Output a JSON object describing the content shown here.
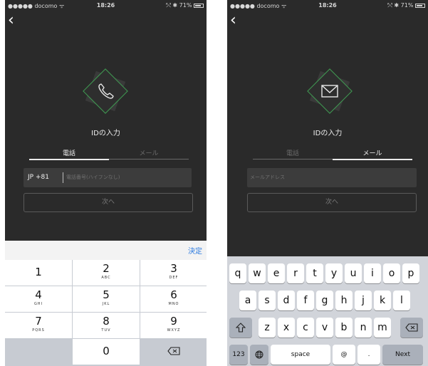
{
  "status": {
    "carrier": "●●●●● docomo ᯤ",
    "time": "18:26",
    "battery_left": "⤲ ✱ 71%",
    "battery_right": "⤲ ✱ 71%"
  },
  "screen": {
    "back": "‹",
    "title": "IDの入力",
    "tab_phone": "電話",
    "tab_mail": "メール",
    "country_code": "JP +81",
    "phone_placeholder": "電話番号(ハイフンなし)",
    "mail_placeholder": "メールアドレス",
    "next": "次へ"
  },
  "numpad": {
    "done": "決定",
    "keys": [
      {
        "digit": "1",
        "letters": ""
      },
      {
        "digit": "2",
        "letters": "ABC"
      },
      {
        "digit": "3",
        "letters": "DEF"
      },
      {
        "digit": "4",
        "letters": "GHI"
      },
      {
        "digit": "5",
        "letters": "JKL"
      },
      {
        "digit": "6",
        "letters": "MNO"
      },
      {
        "digit": "7",
        "letters": "PQRS"
      },
      {
        "digit": "8",
        "letters": "TUV"
      },
      {
        "digit": "9",
        "letters": "WXYZ"
      }
    ],
    "zero": "0"
  },
  "keyboard": {
    "row1": [
      "q",
      "w",
      "e",
      "r",
      "t",
      "y",
      "u",
      "i",
      "o",
      "p"
    ],
    "row2": [
      "a",
      "s",
      "d",
      "f",
      "g",
      "h",
      "j",
      "k",
      "l"
    ],
    "row3": [
      "z",
      "x",
      "c",
      "v",
      "b",
      "n",
      "m"
    ],
    "numbers": "123",
    "space": "space",
    "at": "@",
    "dot": ".",
    "next": "Next"
  },
  "colors": {
    "accent_green": "#3f9a52",
    "done_blue": "#2d7be0"
  }
}
